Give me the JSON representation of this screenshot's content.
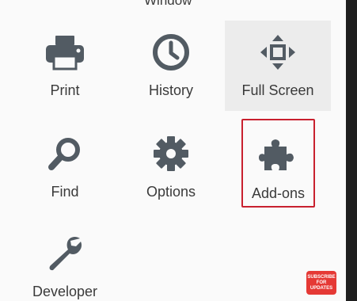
{
  "menu": {
    "title": "Window",
    "items": [
      {
        "label": "Print",
        "icon": "printer-icon"
      },
      {
        "label": "History",
        "icon": "clock-icon"
      },
      {
        "label": "Full Screen",
        "icon": "fullscreen-icon"
      },
      {
        "label": "Find",
        "icon": "magnifier-icon"
      },
      {
        "label": "Options",
        "icon": "gear-icon"
      },
      {
        "label": "Add-ons",
        "icon": "puzzle-icon"
      },
      {
        "label": "Developer",
        "icon": "wrench-icon"
      }
    ]
  },
  "overlay": {
    "line1": "SUBSCRIBE",
    "line2": "FOR",
    "line3": "UPDATES"
  },
  "colors": {
    "icon": "#525b63",
    "highlight": "#ececec",
    "selection_border": "#c8202e",
    "badge": "#e53935"
  }
}
